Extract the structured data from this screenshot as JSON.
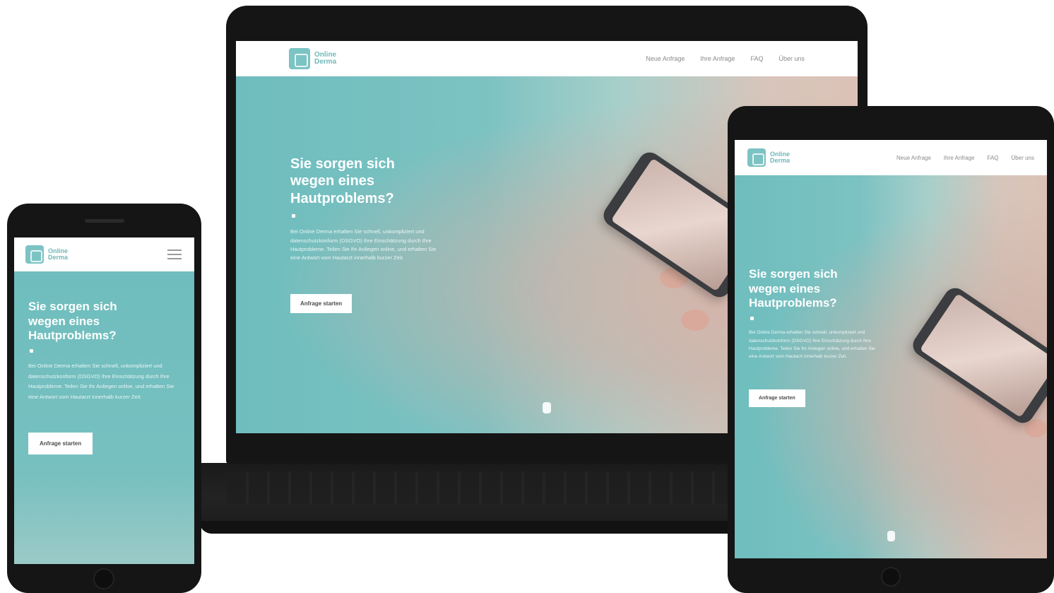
{
  "brand": {
    "name_line1": "Online",
    "name_line2": "Derma",
    "accent_color": "#7bbfc0",
    "frame_color": "#151515"
  },
  "nav": {
    "items": [
      "Neue Anfrage",
      "Ihre Anfrage",
      "FAQ",
      "Über uns"
    ]
  },
  "hero": {
    "title_line1": "Sie sorgen sich",
    "title_line2": "wegen eines",
    "title_line3": "Hautproblems?",
    "body": "Bei Online Derma erhalten Sie schnell, unkompliziert und datenschutzkonform (DSGVO) Ihre Einschätzung durch Ihre Hautprobleme. Teilen Sie Ihr Anliegen online, und erhalten Sie eine Antwort vom Hautarzt innerhalb kurzer Zeit.",
    "cta_label": "Anfrage starten"
  },
  "icons": {
    "menu": "hamburger-icon",
    "logo": "logo-icon",
    "scroll": "mouse-scroll-icon"
  }
}
